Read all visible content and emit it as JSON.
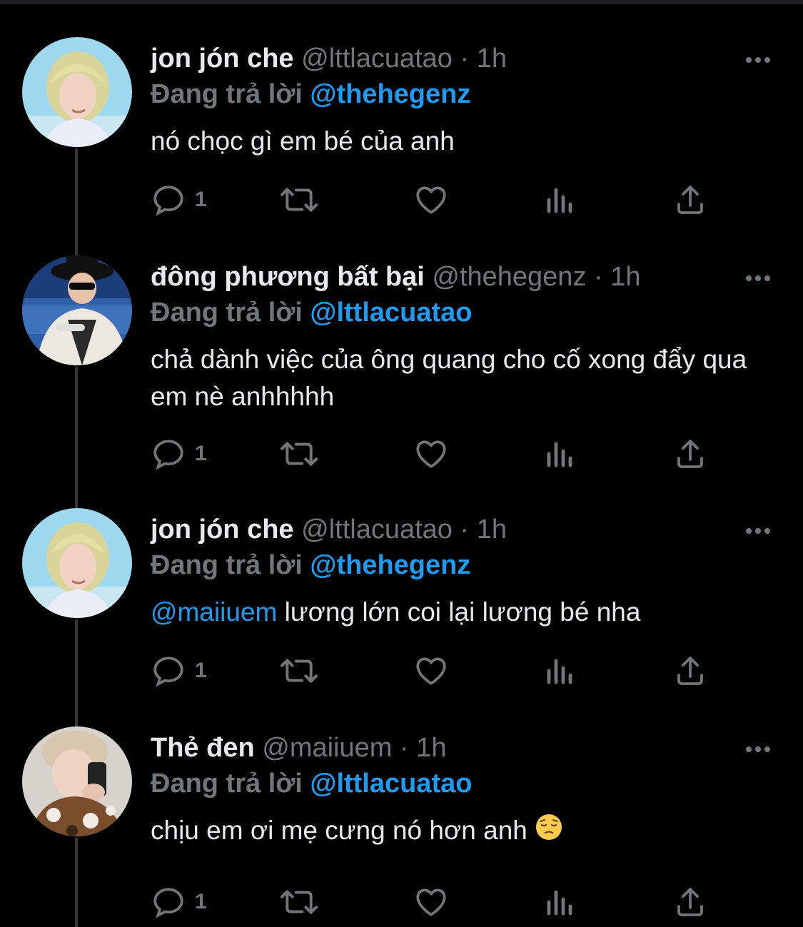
{
  "tweets": [
    {
      "name": "jon jón che",
      "handle": "@lttlacuatao",
      "time": "1h",
      "replying_prefix": "Đang trả lời",
      "replying_to": "@thehegenz",
      "mention": "",
      "text": "nó chọc gì em bé của anh",
      "emoji": "",
      "reply_count": "1",
      "avatar": "avatar-blonde-smiling"
    },
    {
      "name": "đông phương bất bại",
      "handle": "@thehegenz",
      "time": "1h",
      "replying_prefix": "Đang trả lời",
      "replying_to": "@lttlacuatao",
      "mention": "",
      "text": "chả dành việc của ông quang cho cố xong đẩy qua em nè anhhhhh",
      "emoji": "",
      "reply_count": "1",
      "avatar": "avatar-hat-sunglasses"
    },
    {
      "name": "jon jón che",
      "handle": "@lttlacuatao",
      "time": "1h",
      "replying_prefix": "Đang trả lời",
      "replying_to": "@thehegenz",
      "mention": "@maiiuem",
      "text": " lương lớn coi lại lương bé nha",
      "emoji": "",
      "reply_count": "1",
      "avatar": "avatar-blonde-smiling"
    },
    {
      "name": "Thẻ đen",
      "handle": "@maiiuem",
      "time": "1h",
      "replying_prefix": "Đang trả lời",
      "replying_to": "@lttlacuatao",
      "mention": "",
      "text": "chịu em ơi mẹ cưng nó hơn anh ",
      "emoji": "pensive-face-emoji",
      "reply_count": "1",
      "avatar": "avatar-phone-camo"
    }
  ],
  "separator": "·",
  "icons": [
    "reply-icon",
    "retweet-icon",
    "like-icon",
    "views-icon",
    "share-icon",
    "more-icon"
  ],
  "colors": {
    "background": "#000000",
    "name": "#e7e9ea",
    "muted": "#71767b",
    "accent": "#1d9bf0",
    "thread_line": "#333639"
  }
}
